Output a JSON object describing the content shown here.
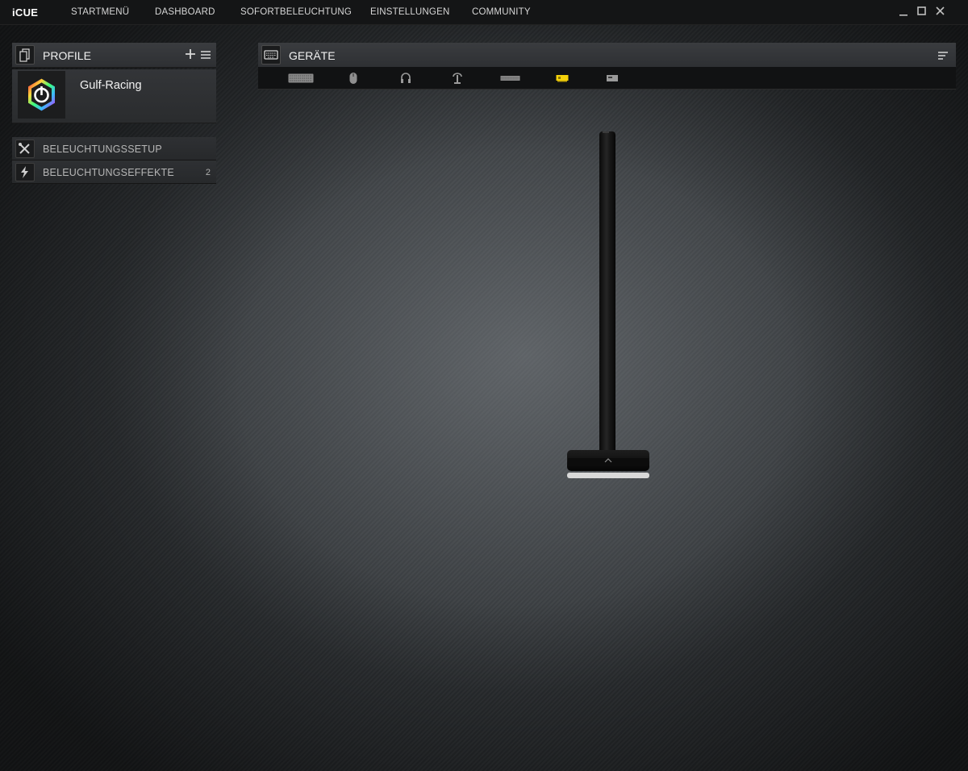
{
  "app": {
    "logo": "iCUE"
  },
  "nav": {
    "items": [
      {
        "label": "STARTMENÜ"
      },
      {
        "label": "DASHBOARD"
      },
      {
        "label": "SOFORTBELEUCHTUNG"
      },
      {
        "label": "EINSTELLUNGEN"
      },
      {
        "label": "COMMUNITY"
      }
    ]
  },
  "window_controls": {
    "minimize_icon": "minimize-icon",
    "maximize_icon": "maximize-icon",
    "close_icon": "close-icon"
  },
  "profiles": {
    "title": "PROFILE",
    "add_icon": "plus-icon",
    "menu_icon": "hamburger-menu-icon",
    "active_profile": {
      "name": "Gulf-Racing",
      "icon": "icue-logo-icon"
    },
    "menu": [
      {
        "label": "BELEUCHTUNGSSETUP",
        "icon": "tools-icon",
        "count": ""
      },
      {
        "label": "BELEUCHTUNGSEFFEKTE",
        "icon": "lightning-icon",
        "count": "2"
      }
    ]
  },
  "devices": {
    "title": "GERÄTE",
    "header_icon": "keyboard-icon",
    "sort_icon": "sort-lines-icon",
    "tabs": [
      {
        "icon": "keyboard-icon",
        "active": false
      },
      {
        "icon": "mouse-icon",
        "active": false
      },
      {
        "icon": "headset-icon",
        "active": false
      },
      {
        "icon": "headset-stand-icon",
        "active": false
      },
      {
        "icon": "keyboard-slim-icon",
        "active": false
      },
      {
        "icon": "memory-module-icon",
        "active": true
      },
      {
        "icon": "controller-box-icon",
        "active": false
      }
    ],
    "preview": "headset-stand-image"
  },
  "colors": {
    "accent_active": "#f5d20a",
    "topbar_bg": "#141516",
    "panel_header_bg": "#3a3c3f"
  }
}
